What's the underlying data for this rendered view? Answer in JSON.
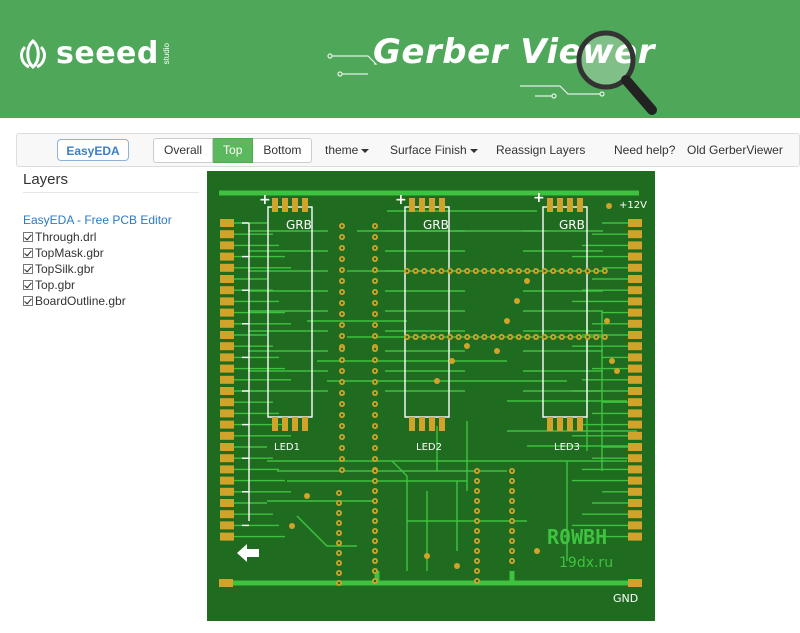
{
  "banner": {
    "brand": "seeed",
    "brand_sub": "studio",
    "title": "Gerber Viewer",
    "bg_color": "#4fa85a"
  },
  "toolbar": {
    "easyeda_badge": "EasyEDA",
    "view_buttons": [
      "Overall",
      "Top",
      "Bottom"
    ],
    "active_view": "Top",
    "active_color": "#5cb85c",
    "menus": {
      "theme": "theme",
      "surface_finish": "Surface Finish",
      "reassign": "Reassign Layers",
      "help": "Need help?",
      "old_viewer": "Old GerberViewer"
    }
  },
  "sidebar": {
    "title": "Layers",
    "link": "EasyEDA - Free PCB Editor",
    "layers": [
      {
        "name": "Through.drl",
        "checked": true
      },
      {
        "name": "TopMask.gbr",
        "checked": true
      },
      {
        "name": "TopSilk.gbr",
        "checked": true
      },
      {
        "name": "Top.gbr",
        "checked": true
      },
      {
        "name": "BoardOutline.gbr",
        "checked": true
      }
    ]
  },
  "board": {
    "bg_color": "#1f6b1f",
    "trace_color": "#3fc23f",
    "pad_color": "#d2a32a",
    "silk_color": "#ffffff",
    "labels": {
      "grb": "GRB",
      "led1": "LED1",
      "led2": "LED2",
      "led3": "LED3",
      "v12": "+12V",
      "gnd": "GND",
      "plus": "+",
      "callsign": "R0WBH",
      "site": "19dx.ru"
    }
  }
}
